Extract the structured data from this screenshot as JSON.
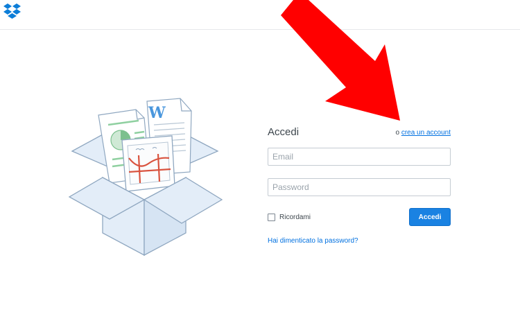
{
  "header": {
    "logo_icon": "dropbox-logo-icon"
  },
  "annotation": {
    "arrow_icon": "red-arrow-icon",
    "arrow_color": "#ff0000"
  },
  "illustration": {
    "icon": "open-box-with-documents-icon",
    "doc_letter": "W"
  },
  "login": {
    "title": "Accedi",
    "or_text": "o",
    "signup_link": "crea un account",
    "email_placeholder": "Email",
    "password_placeholder": "Password",
    "remember_label": "Ricordami",
    "submit_label": "Accedi",
    "forgot_link": "Hai dimenticato la password?"
  },
  "colors": {
    "accent": "#1a82e2",
    "link": "#0070e0",
    "box_fill": "#e3edf8",
    "box_stroke": "#8fa7c0"
  }
}
